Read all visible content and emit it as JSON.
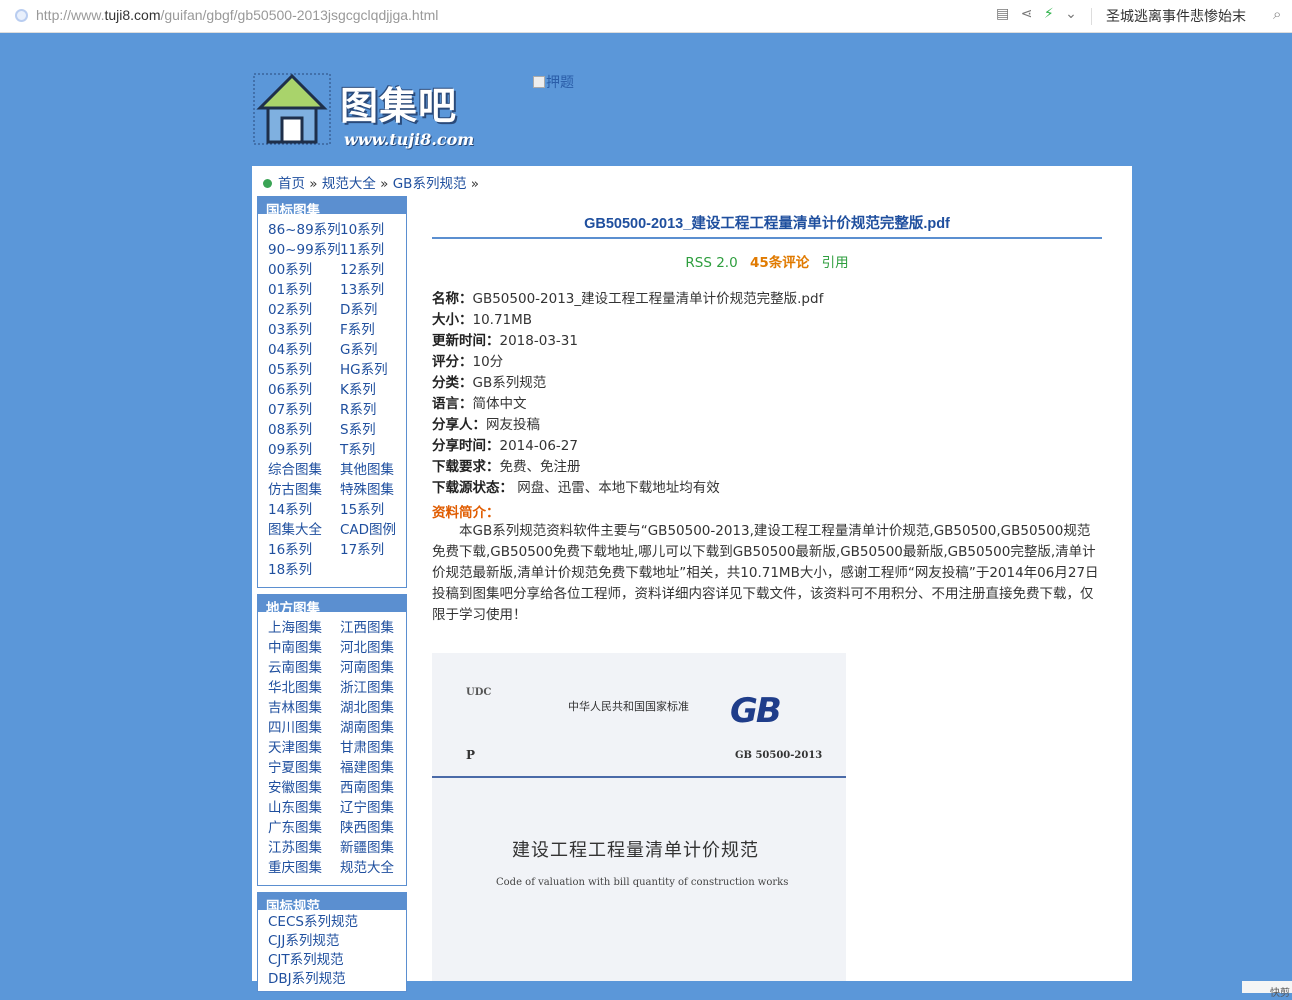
{
  "browser": {
    "url_prefix": "http://www.",
    "url_domain": "tuji8.com",
    "url_path": "/guifan/gbgf/gb50500-2013jsgcgclqdjjga.html",
    "hot_search": "圣城逃离事件悲惨始末"
  },
  "logo": {
    "text": "图集吧",
    "domain": "www.tuji8.com"
  },
  "ad": {
    "alt": "押题"
  },
  "breadcrumb": {
    "home": "首页",
    "sep": "»",
    "l1": "规范大全",
    "l2": "GB系列规范"
  },
  "sidebar": {
    "guobiao": {
      "title": "国标图集",
      "items": [
        "86~89系列",
        "10系列",
        "90~99系列",
        "11系列",
        "00系列",
        "12系列",
        "01系列",
        "13系列",
        "02系列",
        "D系列",
        "03系列",
        "F系列",
        "04系列",
        "G系列",
        "05系列",
        "HG系列",
        "06系列",
        "K系列",
        "07系列",
        "R系列",
        "08系列",
        "S系列",
        "09系列",
        "T系列",
        "综合图集",
        "其他图集",
        "仿古图集",
        "特殊图集",
        "14系列",
        "15系列",
        "图集大全",
        "CAD图例",
        "16系列",
        "17系列",
        "18系列"
      ]
    },
    "difang": {
      "title": "地方图集",
      "items": [
        "上海图集",
        "江西图集",
        "中南图集",
        "河北图集",
        "云南图集",
        "河南图集",
        "华北图集",
        "浙江图集",
        "吉林图集",
        "湖北图集",
        "四川图集",
        "湖南图集",
        "天津图集",
        "甘肃图集",
        "宁夏图集",
        "福建图集",
        "安徽图集",
        "西南图集",
        "山东图集",
        "辽宁图集",
        "广东图集",
        "陕西图集",
        "江苏图集",
        "新疆图集",
        "重庆图集",
        "规范大全"
      ]
    },
    "guifan": {
      "title": "国标规范",
      "items": [
        "CECS系列规范",
        "CJJ系列规范",
        "CJT系列规范",
        "DBJ系列规范"
      ]
    }
  },
  "article": {
    "title": "GB50500-2013_建设工程工程量清单计价规范完整版.pdf",
    "rss": "RSS 2.0",
    "comments": "45条评论",
    "cite": "引用",
    "fields": [
      {
        "k": "名称：",
        "v": "GB50500-2013_建设工程工程量清单计价规范完整版.pdf"
      },
      {
        "k": "大小：",
        "v": "10.71MB"
      },
      {
        "k": "更新时间：",
        "v": "2018-03-31"
      },
      {
        "k": "评分：",
        "v": "10分"
      },
      {
        "k": "分类：",
        "v": "GB系列规范"
      },
      {
        "k": "语言：",
        "v": "简体中文"
      },
      {
        "k": "分享人：",
        "v": "网友投稿"
      },
      {
        "k": "分享时间：",
        "v": "2014-06-27"
      },
      {
        "k": "下载要求：",
        "v": "免费、免注册"
      },
      {
        "k": "下载源状态：",
        "v": " 网盘、迅雷、本地下载地址均有效"
      }
    ],
    "intro_title": "资料简介：",
    "intro": "本GB系列规范资料软件主要与“GB50500-2013,建设工程工程量清单计价规范,GB50500,GB50500规范免费下载,GB50500免费下载地址,哪儿可以下载到GB50500最新版,GB50500最新版,GB50500完整版,清单计价规范最新版,清单计价规范免费下载地址”相关，共10.71MB大小，感谢工程师“网友投稿”于2014年06月27日投稿到图集吧分享给各位工程师，资料详细内容详见下载文件，该资料可不用积分、不用注册直接免费下载，仅限于学习使用！"
  },
  "cover": {
    "udc": "UDC",
    "national": "中华人民共和国国家标准",
    "gb": "GB",
    "p": "P",
    "code": "GB 50500-2013",
    "title_cn": "建设工程工程量清单计价规范",
    "title_en": "Code of valuation with bill quantity of construction works"
  },
  "status": {
    "text": "快剪"
  }
}
